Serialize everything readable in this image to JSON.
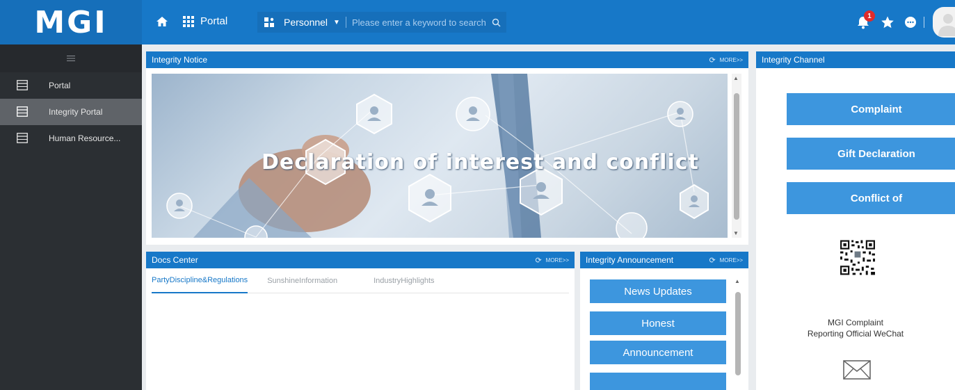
{
  "topbar": {
    "logo": "MGI",
    "portal_label": "Portal",
    "personnel_label": "Personnel",
    "search_placeholder": "Please enter a keyword to search",
    "notification_count": "1",
    "colors": {
      "primary": "#1778c8",
      "badge": "#e02b2b"
    }
  },
  "sidebar": {
    "items": [
      {
        "label": "Portal",
        "active": false
      },
      {
        "label": "Integrity Portal",
        "active": true
      },
      {
        "label": "Human Resource..."
      }
    ]
  },
  "integrity_notice": {
    "title": "Integrity Notice",
    "more": "MORE>>",
    "banner_title": "Declaration of interest and conflict"
  },
  "docs_center": {
    "title": "Docs Center",
    "more": "MORE>>",
    "tabs": [
      "PartyDiscipline&Regulations",
      "SunshineInformation",
      "IndustryHighlights"
    ]
  },
  "integrity_announcement": {
    "title": "Integrity Announcement",
    "more": "MORE>>",
    "buttons": [
      "News Updates",
      "Honest",
      "Announcement",
      ""
    ]
  },
  "integrity_channel": {
    "title": "Integrity Channel",
    "buttons": [
      "Complaint",
      "Gift Declaration",
      "Conflict of"
    ],
    "qr_caption_line1": "MGI Complaint",
    "qr_caption_line2": "Reporting Official WeChat"
  },
  "icons": [
    "home-icon",
    "apps-grid-icon",
    "personnel-icon",
    "search-icon",
    "bell-icon",
    "star-icon",
    "chat-icon",
    "menu-icon",
    "refresh-icon",
    "mail-icon",
    "qr-code"
  ]
}
